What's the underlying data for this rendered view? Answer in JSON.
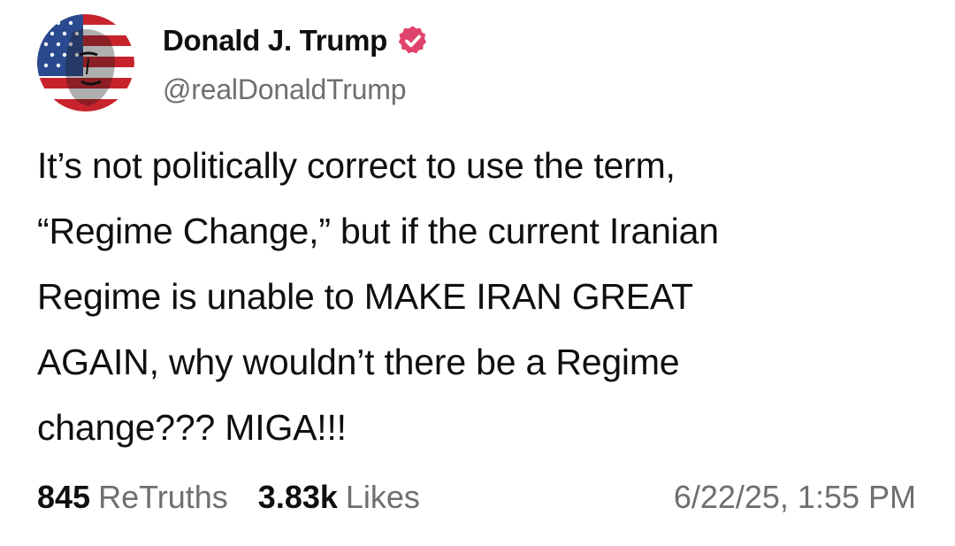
{
  "colors": {
    "verified_badge": "#e0436c",
    "muted_text": "#6e6e73",
    "primary_text": "#0f0f0f"
  },
  "author": {
    "display_name": "Donald J. Trump",
    "handle": "@realDonaldTrump",
    "avatar_icon": "avatar-icon",
    "badge_icon": "verified-badge-icon"
  },
  "post": {
    "text": "It’s not politically correct to use the term,\n“Regime Change,” but if the current Iranian\nRegime is unable to MAKE IRAN GREAT\nAGAIN, why wouldn’t there be a Regime\nchange??? MIGA!!!"
  },
  "stats": {
    "retruths_count": "845",
    "retruths_label": "ReTruths",
    "likes_count": "3.83k",
    "likes_label": "Likes"
  },
  "timestamp": "6/22/25, 1:55 PM"
}
